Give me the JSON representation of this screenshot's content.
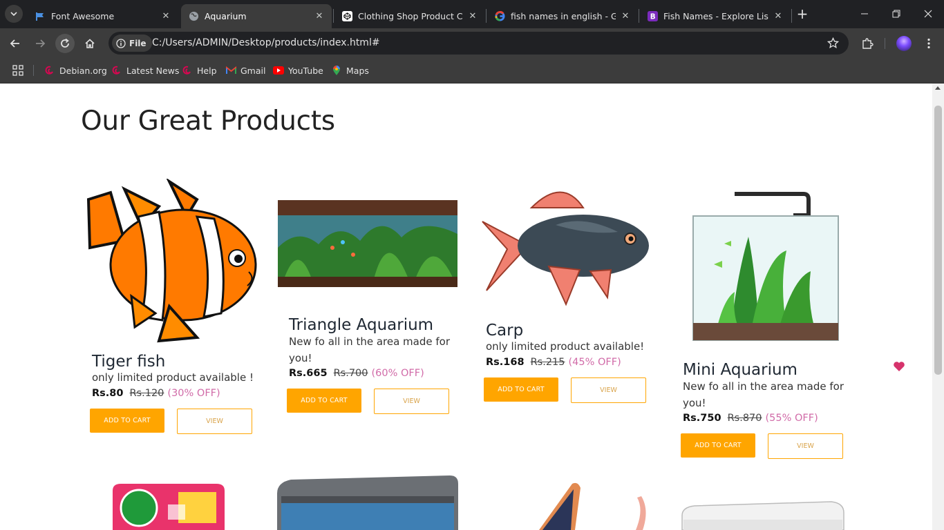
{
  "browser": {
    "tabs": [
      {
        "title": "Font Awesome",
        "favicon": "flag-icon"
      },
      {
        "title": "Aquarium",
        "favicon": "globe-icon",
        "active": true
      },
      {
        "title": "Clothing Shop Product Card",
        "favicon": "codepen-icon"
      },
      {
        "title": "fish names in english - Goog",
        "favicon": "google-icon"
      },
      {
        "title": "Fish Names - Explore List of",
        "favicon": "bootstrap-icon"
      }
    ],
    "address": {
      "chip": "File",
      "url": "C:/Users/ADMIN/Desktop/products/index.html#"
    },
    "bookmarks": [
      {
        "label": "Debian.org",
        "icon": "debian-icon"
      },
      {
        "label": "Latest News",
        "icon": "debian-icon"
      },
      {
        "label": "Help",
        "icon": "debian-icon"
      },
      {
        "label": "Gmail",
        "icon": "gmail-icon"
      },
      {
        "label": "YouTube",
        "icon": "youtube-icon"
      },
      {
        "label": "Maps",
        "icon": "maps-icon"
      }
    ]
  },
  "page": {
    "heading": "Our Great Products",
    "products": [
      {
        "name": "Tiger fish",
        "desc": "only limited product available !",
        "price": "Rs.80",
        "old_price": "Rs.120",
        "discount": "(30% OFF)",
        "cart_label": "ADD TO CART",
        "view_label": "VIEW"
      },
      {
        "name": "Triangle Aquarium",
        "desc": "New fo all in the area made for you!",
        "price": "Rs.665",
        "old_price": "Rs.700",
        "discount": "(60% OFF)",
        "cart_label": "ADD TO CART",
        "view_label": "VIEW"
      },
      {
        "name": "Carp",
        "desc": "only limited product available!",
        "price": "Rs.168",
        "old_price": "Rs.215",
        "discount": "(45% OFF)",
        "cart_label": "ADD TO CART",
        "view_label": "VIEW"
      },
      {
        "name": "Mini Aquarium",
        "desc": "New fo all in the area made for you!",
        "price": "Rs.750",
        "old_price": "Rs.870",
        "discount": "(55% OFF)",
        "cart_label": "ADD TO CART",
        "view_label": "VIEW",
        "favorite": true
      }
    ],
    "colors": {
      "accent": "#ffa500",
      "discount": "#d16ba8",
      "heart": "#d6336c"
    }
  }
}
